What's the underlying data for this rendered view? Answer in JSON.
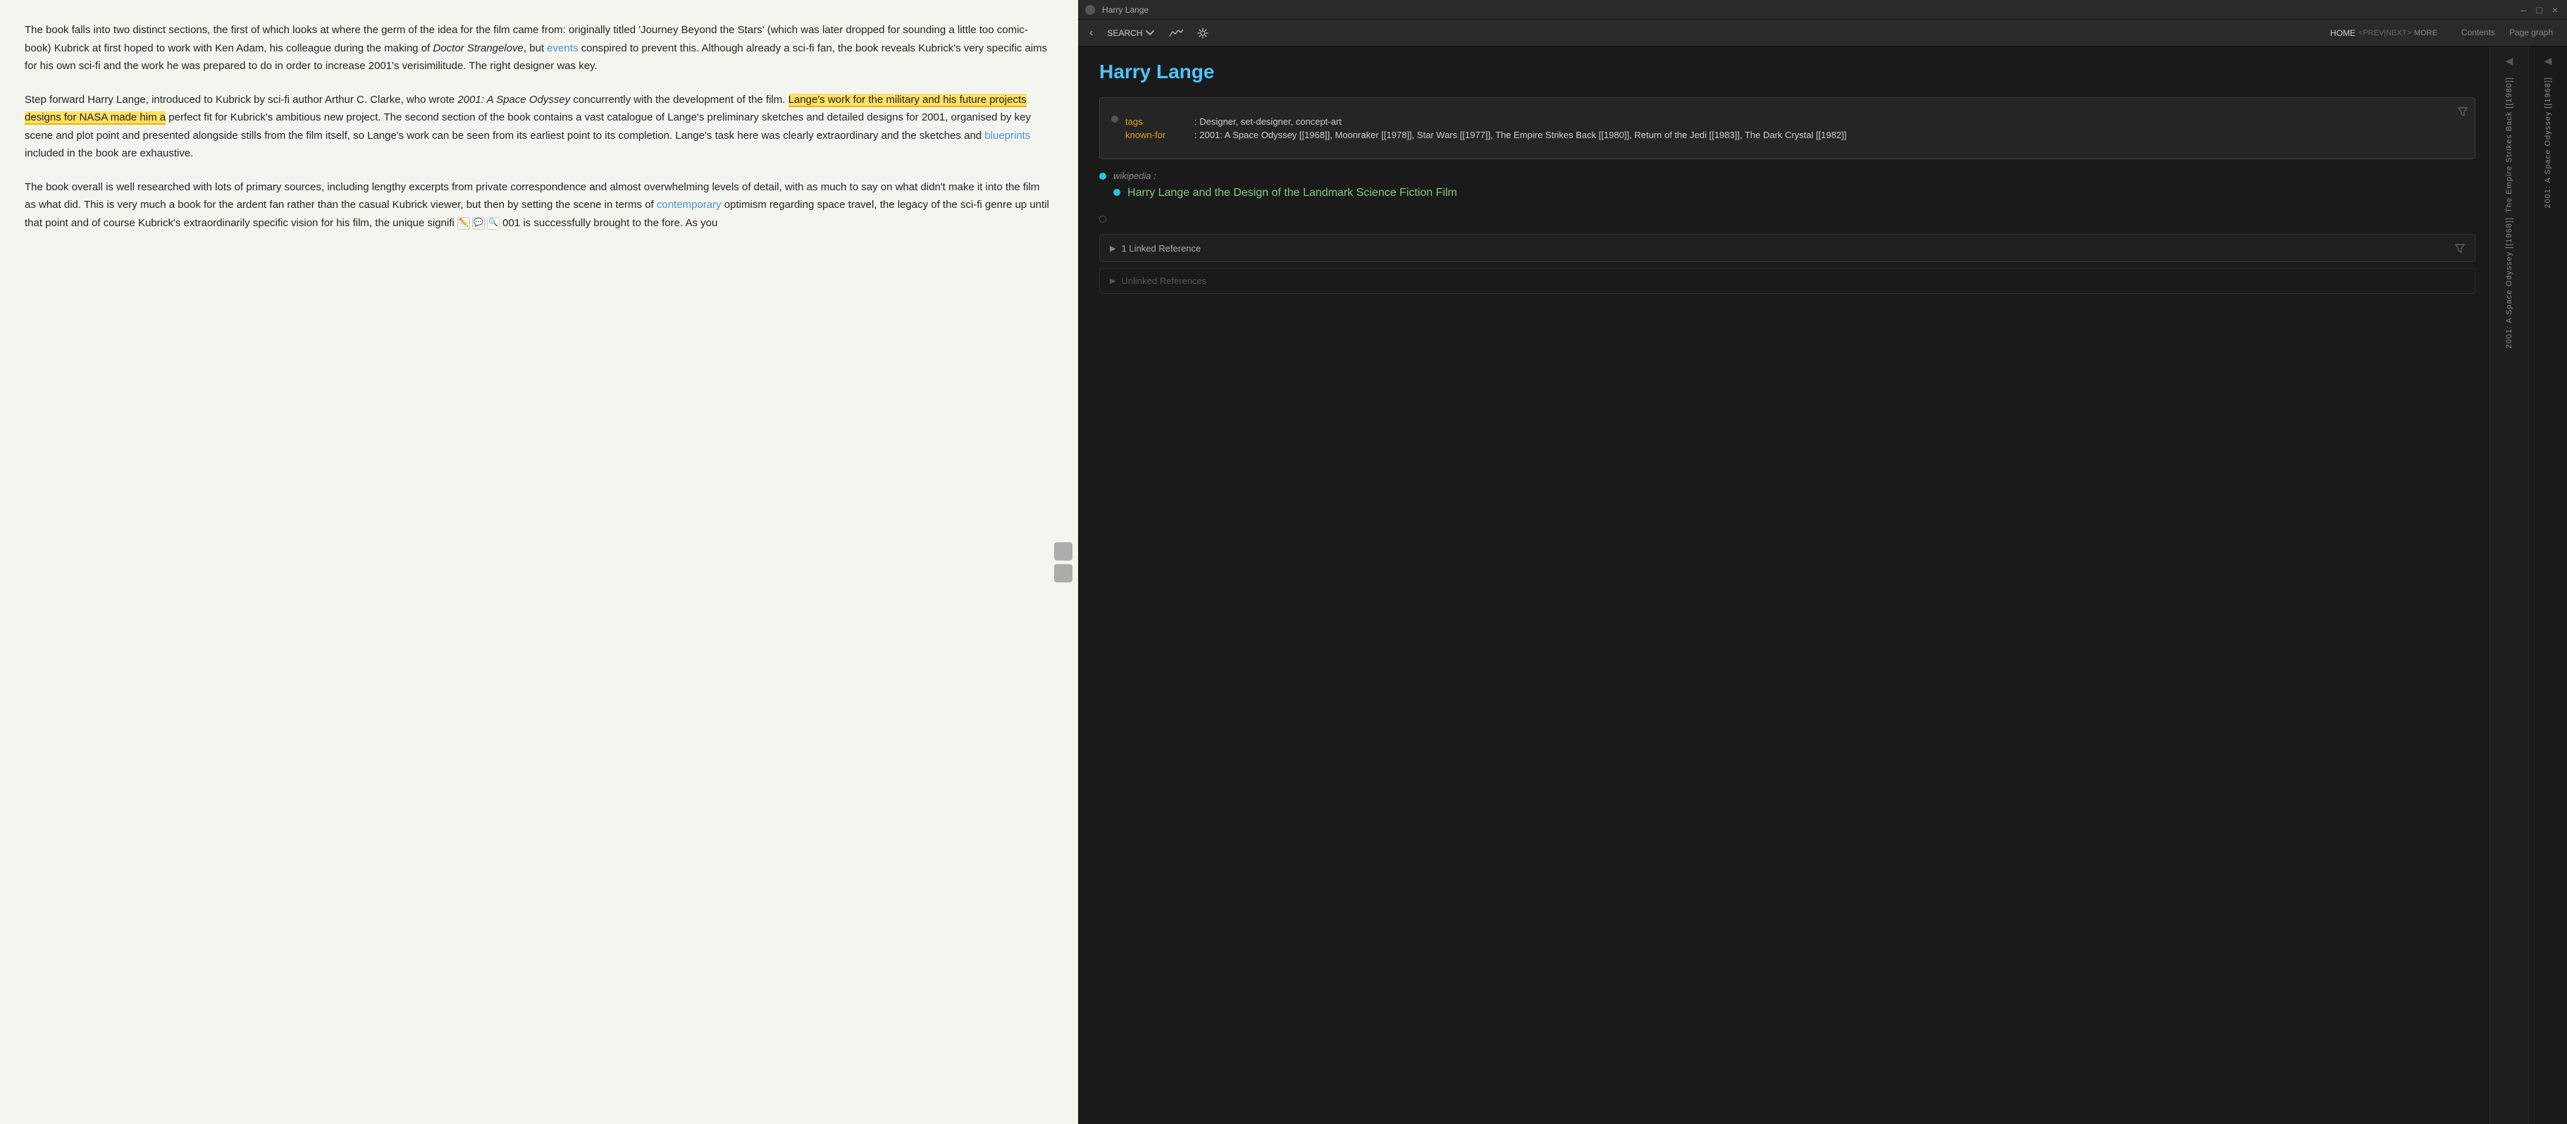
{
  "left": {
    "paragraphs": [
      "The book falls into two distinct sections, the first of which looks at where the germ of the idea for the film came from: originally titled 'Journey Beyond the Stars' (which was later dropped for sounding a little too comic-book) Kubrick at first hoped to work with Ken Adam, his colleague during the making of Doctor Strangelove, but events conspired to prevent this. Although already a sci-fi fan, the book reveals Kubrick's very specific aims for his own sci-fi and the work he was prepared to do in order to increase 2001's verisimilitude. The right designer was key.",
      "Step forward Harry Lange, introduced to Kubrick by sci-fi author Arthur C. Clarke, who wrote 2001: A Space Odyssey concurrently with the development of the film. Lange's work for the military and his future projects designs for NASA made him a perfect fit for Kubrick's ambitious new project. The second section of the book contains a vast catalogue of Lange's preliminary sketches and detailed designs for 2001, organised by key scene and plot point and presented alongside stills from the film itself, so Lange's work can be seen from its earliest point to its completion. Lange's task here was clearly extraordinary and the sketches and blueprints included in the book are exhaustive.",
      "The book overall is well researched with lots of primary sources, including lengthy excerpts from private correspondence and almost overwhelming levels of detail, with as much to say on what didn't make it into the film as what did. This is very much a book for the ardent fan rather than the casual Kubrick viewer, but then by setting the scene in terms of contemporary optimism regarding space travel, the legacy of the sci-fi genre up until that point and of course Kubrick's extraordinarily specific vision for his film, the unique signifi ✏️ 💬 🔍 001 is successfully brought to the fore. As you"
    ],
    "links": {
      "events": "events",
      "contemporary": "contemporary",
      "blueprints": "blueprints"
    }
  },
  "titlebar": {
    "app_name": "Harry Lange",
    "window_controls": [
      "–",
      "□",
      "×"
    ]
  },
  "toolbar": {
    "back_label": "‹",
    "search_label": "SEARCH",
    "home_label": "HOME",
    "nav_label": "<PREV|NEXT>",
    "more_label": "MORE",
    "contents_tab": "Contents",
    "page_graph_tab": "Page graph"
  },
  "page": {
    "title": "Harry Lange",
    "info_block": {
      "tags_key": "tags",
      "tags_value": ": Designer, set-designer, concept-art",
      "known_for_key": "known-for",
      "known_for_value": ": 2001: A Space Odyssey [[1968]], Moonraker [[1978]], Star Wars [[1977]], The Empire Strikes Back [[1980]], Return of the Jedi [[1983]], The Dark Crystal [[1982]]"
    },
    "wikipedia": {
      "label": "wikipedia :",
      "article_title": "Harry Lange and the Design of the Landmark Science Fiction Film"
    },
    "linked_references": {
      "label": "1 Linked Reference",
      "expand_icon": "▶"
    },
    "unlinked_references": {
      "label": "Unlinked References",
      "expand_icon": "▶"
    }
  },
  "right_sidebar": {
    "arrow": "◀",
    "text": "2001: A Space Odyssey [[1968]]",
    "sub_text": "The Empire Strikes Back [[1980]]"
  },
  "far_right_sidebar": {
    "arrow": "◀",
    "text": "2001: A Space Odyssey [[1968]]"
  }
}
